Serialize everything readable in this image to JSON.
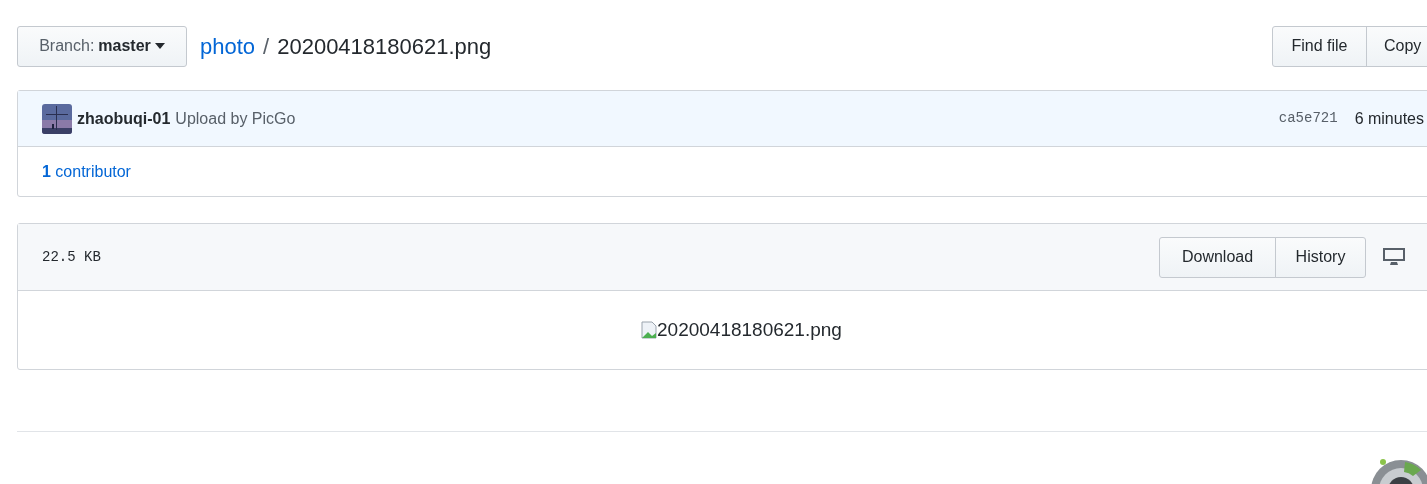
{
  "branch_button": {
    "label": "Branch:",
    "value": "master"
  },
  "breadcrumb": {
    "repo": "photo",
    "separator": "/",
    "file": "20200418180621.png"
  },
  "file_actions": [
    "Find file",
    "Copy"
  ],
  "commit": {
    "author": "zhaobuqi-01",
    "message": "Upload by PicGo",
    "sha": "ca5e721",
    "time": "6 minutes"
  },
  "contributors": {
    "count": "1",
    "label": "contributor"
  },
  "file_header": {
    "size": "22.5 KB",
    "buttons": [
      "Download",
      "History"
    ]
  },
  "file_body": {
    "image_alt": "20200418180621.png"
  }
}
